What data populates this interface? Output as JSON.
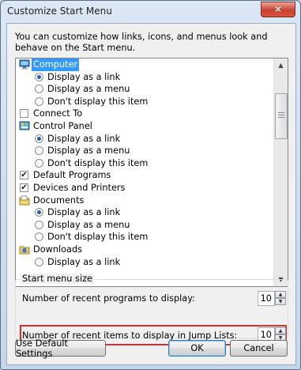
{
  "window": {
    "title": "Customize Start Menu",
    "close_glyph": "✕"
  },
  "description": "You can customize how links, icons, and menus look and behave on the Start menu.",
  "list": [
    {
      "kind": "item",
      "icon": "computer-icon",
      "label": "Computer",
      "selected": true
    },
    {
      "kind": "radio",
      "label": "Display as a link",
      "checked": true
    },
    {
      "kind": "radio",
      "label": "Display as a menu",
      "checked": false
    },
    {
      "kind": "radio",
      "label": "Don't display this item",
      "checked": false
    },
    {
      "kind": "checkbox",
      "label": "Connect To",
      "checked": false
    },
    {
      "kind": "item",
      "icon": "control-panel-icon",
      "label": "Control Panel",
      "selected": false
    },
    {
      "kind": "radio",
      "label": "Display as a link",
      "checked": true
    },
    {
      "kind": "radio",
      "label": "Display as a menu",
      "checked": false
    },
    {
      "kind": "radio",
      "label": "Don't display this item",
      "checked": false
    },
    {
      "kind": "checkbox",
      "label": "Default Programs",
      "checked": true
    },
    {
      "kind": "checkbox",
      "label": "Devices and Printers",
      "checked": true
    },
    {
      "kind": "item",
      "icon": "documents-icon",
      "label": "Documents",
      "selected": false
    },
    {
      "kind": "radio",
      "label": "Display as a link",
      "checked": true
    },
    {
      "kind": "radio",
      "label": "Display as a menu",
      "checked": false
    },
    {
      "kind": "radio",
      "label": "Don't display this item",
      "checked": false
    },
    {
      "kind": "item",
      "icon": "downloads-icon",
      "label": "Downloads",
      "selected": false
    },
    {
      "kind": "radio",
      "label": "Display as a link",
      "checked": false
    }
  ],
  "start_menu_size": {
    "title": "Start menu size",
    "recent_programs_label": "Number of recent programs to display:",
    "recent_programs_value": "10",
    "recent_items_label": "Number of recent items to display in Jump Lists:",
    "recent_items_value": "10"
  },
  "buttons": {
    "defaults": "Use Default Settings",
    "ok": "OK",
    "cancel": "Cancel"
  },
  "colors": {
    "selection": "#3399ff",
    "highlight_box": "#d9302a"
  }
}
